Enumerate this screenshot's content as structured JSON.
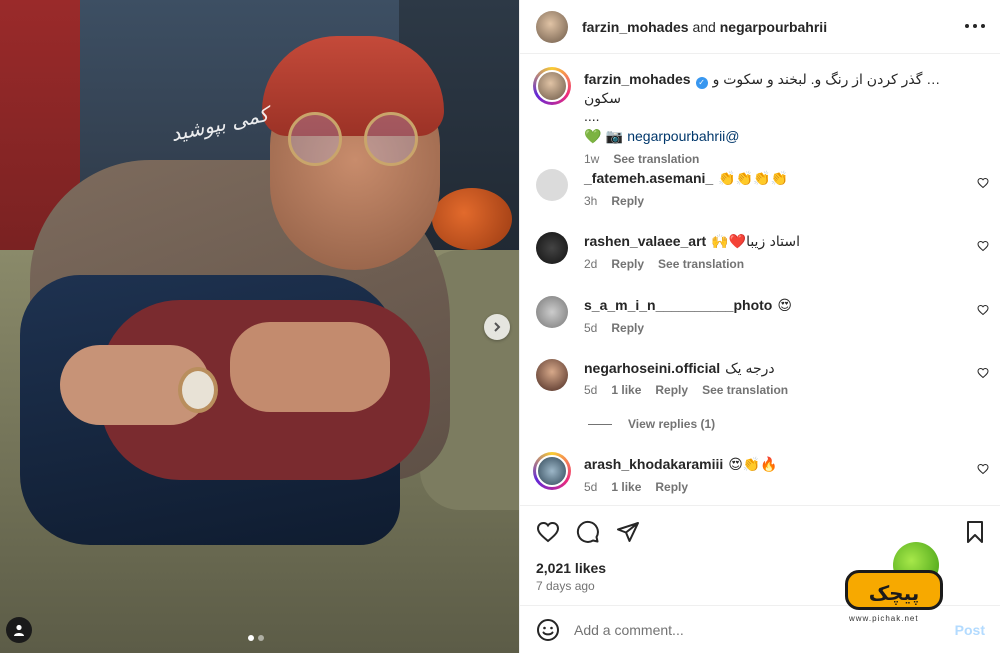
{
  "media": {
    "signature_text": "کمی بپوشید",
    "next_icon": "chevron-right-icon",
    "tag_icon": "person-tag-icon",
    "carousel_dots": 2,
    "active_dot": 0
  },
  "header": {
    "user1": "farzin_mohades",
    "and": "and",
    "user2": "negarpourbahrii",
    "more_icon": "more-horizontal-icon"
  },
  "caption": {
    "username": "farzin_mohades",
    "verified_icon": "verified-check-icon",
    "text": "… گذر کردن از رنگ و. لبخند و سکوت و سکون",
    "text2": "....",
    "emoji_line": "💚 📷",
    "mention": "negarpourbahrii@",
    "time": "1w",
    "see_translation": "See translation"
  },
  "comments": [
    {
      "username": "_fatemeh.asemani_",
      "text": "👏👏👏👏",
      "time": "3h",
      "reply": "Reply"
    },
    {
      "username": "rashen_valaee_art",
      "text": "استاد زیبا❤️🙌",
      "time": "2d",
      "reply": "Reply",
      "see_translation": "See translation"
    },
    {
      "username": "s_a_m_i_n__________photo",
      "text": "😍",
      "time": "5d",
      "reply": "Reply"
    },
    {
      "username": "negarhoseini.official",
      "text": "درجه یک",
      "time": "5d",
      "likes": "1 like",
      "reply": "Reply",
      "see_translation": "See translation"
    },
    {
      "username": "arash_khodakaramiii",
      "text": "😍👏🔥",
      "time": "5d",
      "likes": "1 like",
      "reply": "Reply"
    }
  ],
  "view_replies": "View replies (1)",
  "actions": {
    "like_icon": "heart-icon",
    "comment_icon": "comment-icon",
    "share_icon": "send-icon",
    "save_icon": "bookmark-icon",
    "likes": "2,021 likes",
    "date": "7 days ago"
  },
  "add_comment": {
    "emoji_icon": "emoji-icon",
    "placeholder": "Add a comment...",
    "post": "Post"
  },
  "watermark": {
    "word": "پیچک",
    "url": "www.pichak.net"
  },
  "colors": {
    "accent": "#0095f6",
    "post_disabled": "#b3dbff",
    "secondary_text": "#737373",
    "verified": "#3897f0"
  }
}
